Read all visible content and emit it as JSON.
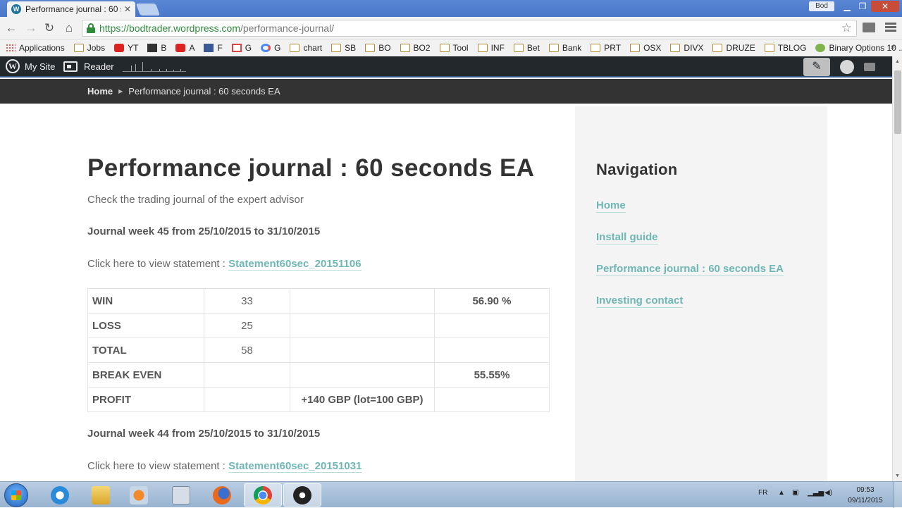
{
  "browser": {
    "tab_title": "Performance journal : 60 s",
    "profile": "Bod",
    "url_scheme_host": "https://bodtrader.wordpress.com",
    "url_path": "/performance-journal/",
    "bookmarks": [
      {
        "label": "Applications",
        "icon": "grid"
      },
      {
        "label": "Jobs",
        "icon": "folder"
      },
      {
        "label": "YT",
        "icon": "red"
      },
      {
        "label": "B",
        "icon": "dark"
      },
      {
        "label": "A",
        "icon": "red"
      },
      {
        "label": "F",
        "icon": "fb"
      },
      {
        "label": "G",
        "icon": "gmail"
      },
      {
        "label": "G",
        "icon": "goog"
      },
      {
        "label": "chart",
        "icon": "folder"
      },
      {
        "label": "SB",
        "icon": "folder"
      },
      {
        "label": "BO",
        "icon": "folder"
      },
      {
        "label": "BO2",
        "icon": "folder"
      },
      {
        "label": "Tool",
        "icon": "folder"
      },
      {
        "label": "INF",
        "icon": "folder"
      },
      {
        "label": "Bet",
        "icon": "folder"
      },
      {
        "label": "Bank",
        "icon": "folder"
      },
      {
        "label": "PRT",
        "icon": "folder"
      },
      {
        "label": "OSX",
        "icon": "folder"
      },
      {
        "label": "DIVX",
        "icon": "folder"
      },
      {
        "label": "DRUZE",
        "icon": "folder"
      },
      {
        "label": "TBLOG",
        "icon": "folder"
      },
      {
        "label": "Binary Options 10 ...",
        "icon": "green"
      }
    ],
    "bookmarks_more": "»"
  },
  "wpbar": {
    "my_site": "My Site",
    "reader": "Reader"
  },
  "breadcrumb": {
    "home": "Home",
    "current": "Performance journal : 60 seconds EA"
  },
  "page": {
    "title": "Performance journal : 60 seconds EA",
    "subtitle": "Check the trading journal of the expert advisor",
    "weeks": [
      {
        "heading": "Journal week 45 from 25/10/2015 to 31/10/2015",
        "statement_prefix": "Click here to view statement : ",
        "statement_link": "Statement60sec_20151106"
      },
      {
        "heading": "Journal week 44 from 25/10/2015 to 31/10/2015",
        "statement_prefix": "Click here to view statement : ",
        "statement_link": "Statement60sec_20151031"
      }
    ],
    "table": [
      [
        "WIN",
        "33",
        "",
        "56.90  %"
      ],
      [
        "LOSS",
        "25",
        "",
        ""
      ],
      [
        "TOTAL",
        "58",
        "",
        ""
      ],
      [
        "BREAK EVEN",
        "",
        "",
        "55.55%"
      ],
      [
        "PROFIT",
        "",
        "+140 GBP (lot=100 GBP)",
        ""
      ]
    ]
  },
  "sidebar": {
    "heading": "Navigation",
    "links": [
      "Home",
      "Install guide",
      "Performance journal : 60 seconds EA",
      "Investing contact"
    ]
  },
  "taskbar": {
    "apps": [
      "ie-icon",
      "explorer-icon",
      "media-player-icon",
      "calculator-icon",
      "firefox-icon",
      "chrome-icon",
      "obs-icon"
    ],
    "lang": "FR",
    "time": "09:53",
    "date": "09/11/2015"
  },
  "colors": {
    "link": "#6fb7b4",
    "admin_bar": "#23282d",
    "crumb_band": "#333333",
    "sidebar_bg": "#f4f4f4"
  }
}
